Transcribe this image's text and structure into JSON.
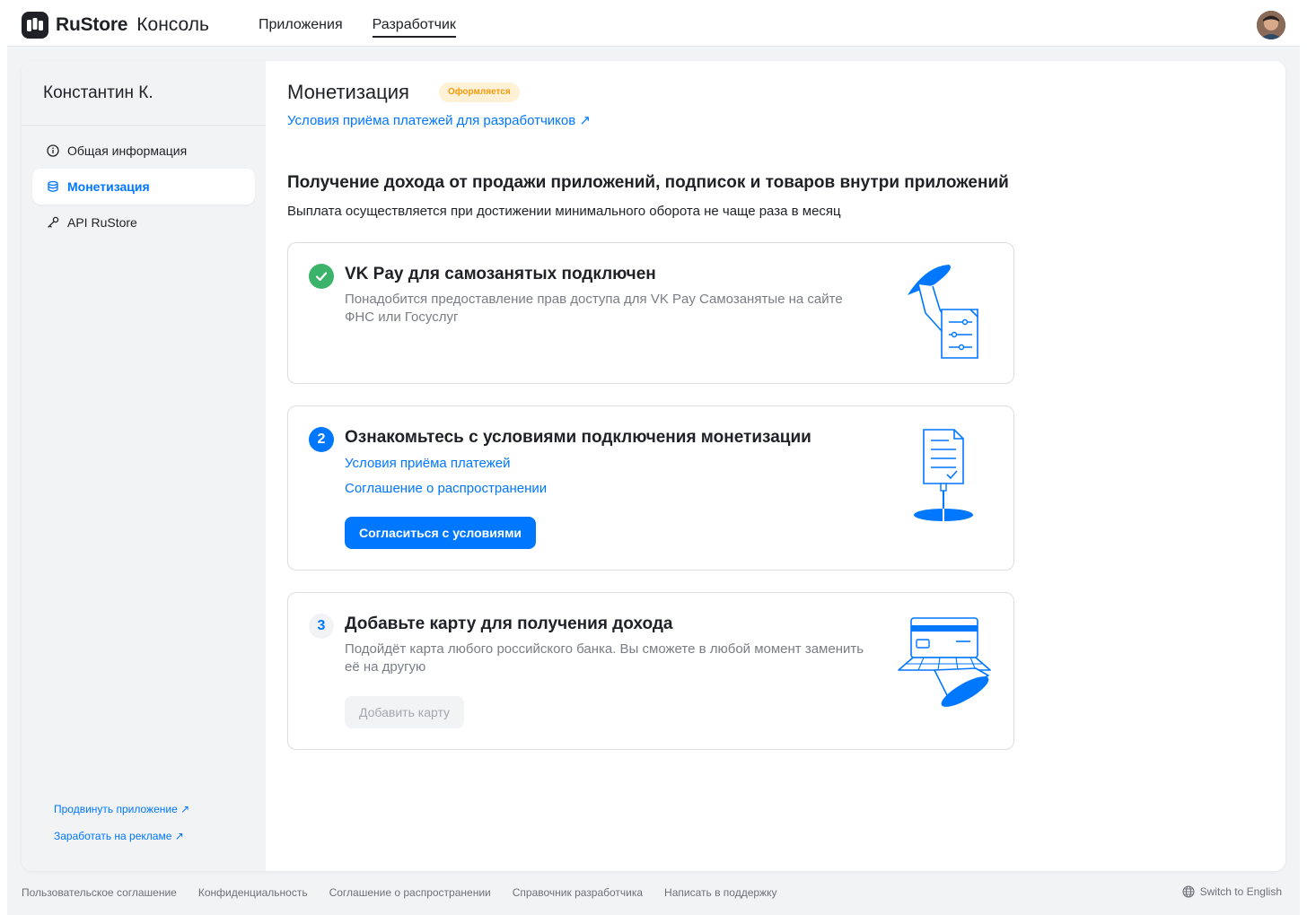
{
  "header": {
    "brand": "RuStore",
    "brand_sub": "Консоль",
    "nav": [
      {
        "label": "Приложения",
        "active": false
      },
      {
        "label": "Разработчик",
        "active": true
      }
    ]
  },
  "sidebar": {
    "user_name": "Константин К.",
    "items": [
      {
        "label": "Общая информация",
        "icon": "info-icon",
        "active": false
      },
      {
        "label": "Монетизация",
        "icon": "coins-icon",
        "active": true
      },
      {
        "label": "API RuStore",
        "icon": "key-icon",
        "active": false
      }
    ],
    "links": [
      {
        "label": "Продвинуть приложение ↗"
      },
      {
        "label": "Заработать на рекламе ↗"
      }
    ]
  },
  "main": {
    "title": "Монетизация",
    "status_badge": "Оформляется",
    "terms_link": "Условия приёма платежей для разработчиков ↗",
    "section_title": "Получение дохода от продажи приложений, подписок и товаров внутри приложений",
    "section_subtitle": "Выплата осуществляется при достижении минимального оборота не чаще раза в месяц",
    "steps": [
      {
        "status": "done",
        "title": "VK Pay для самозанятых подключен",
        "description": "Понадобится предоставление прав доступа для VK Pay Самозанятые на сайте ФНС или Госуслуг"
      },
      {
        "number": "2",
        "status": "current",
        "title": "Ознакомьтесь с условиями подключения монетизации",
        "links": [
          "Условия приёма платежей",
          "Соглашение о распространении"
        ],
        "button": "Согласиться с условиями"
      },
      {
        "number": "3",
        "status": "pending",
        "title": "Добавьте карту для получения дохода",
        "description": "Подойдёт карта любого российского банка. Вы сможете в любой момент заменить её на другую",
        "button": "Добавить карту"
      }
    ]
  },
  "footer": {
    "links": [
      "Пользовательское соглашение",
      "Конфиденциальность",
      "Соглашение о распространении",
      "Справочник разработчика",
      "Написать в поддержку"
    ],
    "language": "Switch to English"
  },
  "colors": {
    "accent": "#0077ff",
    "success": "#3bb36a",
    "badge_bg": "#fff1d6",
    "badge_text": "#f09a0c",
    "sidebar_bg": "#f2f3f5"
  }
}
